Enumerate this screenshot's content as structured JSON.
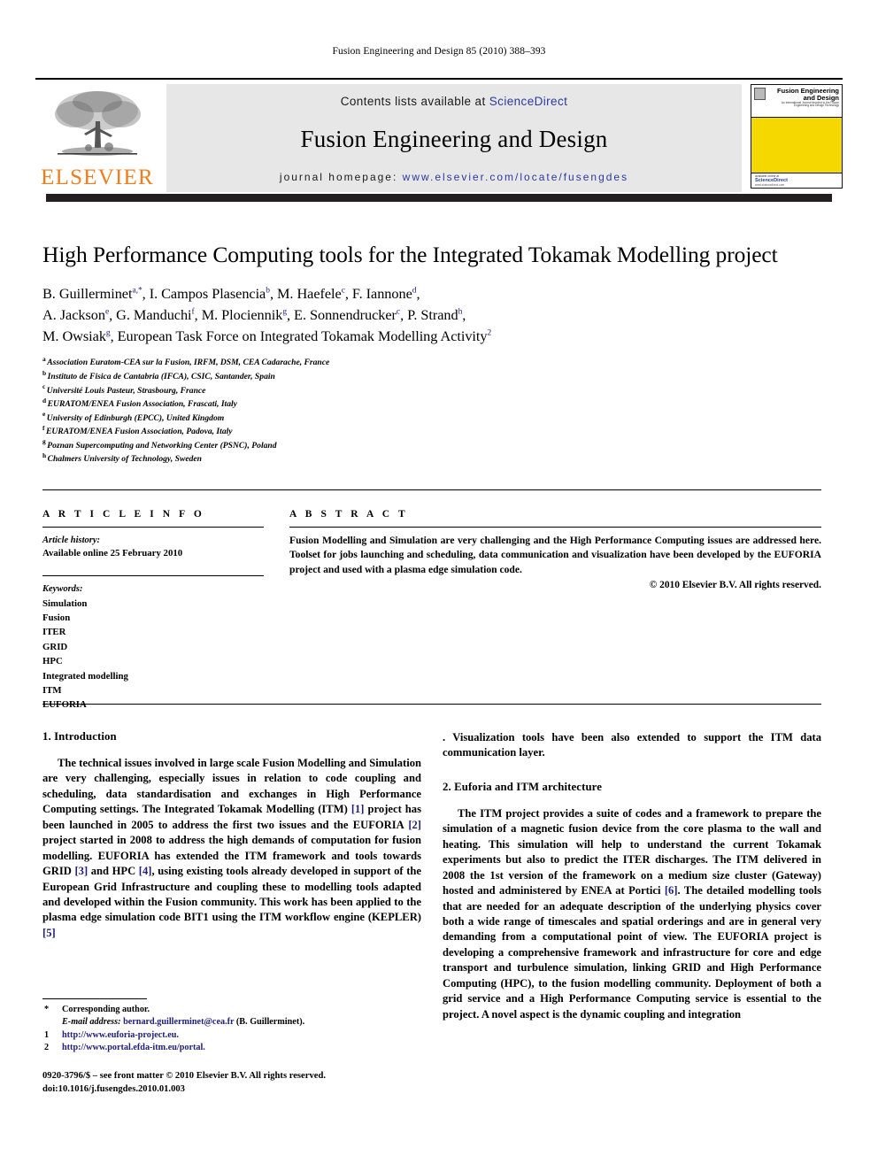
{
  "running_head": "Fusion Engineering and Design 85 (2010) 388–393",
  "masthead": {
    "contents_prefix": "Contents lists available at ",
    "sciencedirect": "ScienceDirect",
    "journal_title": "Fusion Engineering and Design",
    "homepage_prefix": "journal homepage:",
    "homepage_url": "www.elsevier.com/locate/fusengdes",
    "publisher_name": "ELSEVIER",
    "cover": {
      "title_line1": "Fusion Engineering",
      "title_line2": "and Design",
      "subtitle": "An International Journal devoted to the Fusion Engineering and Design Technology",
      "footer_line1": "available online at",
      "footer_line2": "ScienceDirect",
      "footer_line3": "www.sciencedirect.com"
    },
    "accent_link_color": "#2b3a9c",
    "elsevier_orange": "#f07d1a",
    "cover_yellow": "#f5d800",
    "band_gray": "#e7e7e8"
  },
  "article": {
    "title": "High Performance Computing tools for the Integrated Tokamak Modelling project",
    "authors_line1": "B. Guillerminet",
    "authors_html_lines": [
      "B. Guillerminet a,*, I. Campos Plasencia b, M. Haefele c, F. Iannone d,",
      "A. Jackson e, G. Manduchi f, M. Plociennik g, E. Sonnendrucker c, P. Strand h,",
      "M. Owsiak g, European Task Force on Integrated Tokamak Modelling Activity 2"
    ],
    "affiliations": [
      {
        "mark": "a",
        "text": "Association Euratom-CEA sur la Fusion, IRFM, DSM, CEA Cadarache, France"
      },
      {
        "mark": "b",
        "text": "Instituto de Fisica de Cantabria (IFCA), CSIC, Santander, Spain"
      },
      {
        "mark": "c",
        "text": "Université Louis Pasteur, Strasbourg, France"
      },
      {
        "mark": "d",
        "text": "EURATOM/ENEA Fusion Association, Frascati, Italy"
      },
      {
        "mark": "e",
        "text": "University of Edinburgh (EPCC), United Kingdom"
      },
      {
        "mark": "f",
        "text": "EURATOM/ENEA Fusion Association, Padova, Italy"
      },
      {
        "mark": "g",
        "text": "Poznan Supercomputing and Networking Center (PSNC), Poland"
      },
      {
        "mark": "h",
        "text": "Chalmers University of Technology, Sweden"
      }
    ]
  },
  "article_info": {
    "heading": "A R T I C L E   I N F O",
    "history_label": "Article history:",
    "history_value": "Available online 25 February 2010",
    "keywords_label": "Keywords:",
    "keywords": [
      "Simulation",
      "Fusion",
      "ITER",
      "GRID",
      "HPC",
      "Integrated modelling",
      "ITM",
      "EUFORIA"
    ]
  },
  "abstract": {
    "heading": "A B S T R A C T",
    "text": "Fusion Modelling and Simulation are very challenging and the High Performance Computing issues are addressed here. Toolset for jobs launching and scheduling, data communication and visualization have been developed by the EUFORIA project and used with a plasma edge simulation code.",
    "copyright": "© 2010 Elsevier B.V. All rights reserved."
  },
  "body": {
    "section1_heading": "1.  Introduction",
    "section1_par1_a": "The technical issues involved in large scale Fusion Modelling and Simulation are very challenging, especially issues in relation to code coupling and scheduling, data standardisation and exchanges in High Performance Computing settings. The Integrated Tokamak Modelling (ITM) ",
    "cite1": "[1]",
    "section1_par1_b": " project has been launched in 2005 to address the first two issues and the EUFORIA ",
    "cite2": "[2]",
    "section1_par1_c": " project started in 2008 to address the high demands of computation for fusion modelling. EUFORIA has extended the ITM framework and tools towards GRID ",
    "cite3": "[3]",
    "section1_par1_d": " and HPC ",
    "cite4": "[4]",
    "section1_par1_e": ", using existing tools already developed in support of the European Grid Infrastructure and coupling these to modelling tools adapted and developed within the Fusion community. This work has been applied to the plasma edge simulation code BIT1 using the ITM workflow engine (KEPLER) ",
    "cite5": "[5]",
    "section1_par1_f": ". Visualization tools have been also extended to support the ITM data communication layer.",
    "section2_heading": "2.  Euforia and ITM architecture",
    "section2_par1_a": "The ITM project provides a suite of codes and a framework to prepare the simulation of a magnetic fusion device from the core plasma to the wall and heating. This simulation will help to understand the current Tokamak experiments but also to predict the ITER discharges. The ITM delivered in 2008 the 1st version of the framework on a medium size cluster (Gateway) hosted and administered by ENEA at Portici ",
    "cite6": "[6]",
    "section2_par1_b": ". The detailed modelling tools that are needed for an adequate description of the underlying physics cover both a wide range of timescales and spatial orderings and are in general very demanding from a computational point of view. The EUFORIA project is developing a comprehensive framework and infrastructure for core and edge transport and turbulence simulation, linking GRID and High Performance Computing (HPC), to the fusion modelling community. Deployment of both a grid service and a High Performance Computing service is essential to the project. A novel aspect is the dynamic coupling and integration"
  },
  "footnotes": {
    "corresponding_mark": "*",
    "corresponding_text": "Corresponding author.",
    "email_label": "E-mail address:",
    "email_value": "bernard.guillerminet@cea.fr",
    "email_attrib": "(B. Guillerminet).",
    "note1_mark": "1",
    "note1_url": "http://www.euforia-project.eu.",
    "note2_mark": "2",
    "note2_url": "http://www.portal.efda-itm.eu/portal.",
    "imprint_line1": "0920-3796/$ – see front matter © 2010 Elsevier B.V. All rights reserved.",
    "imprint_line2": "doi:10.1016/j.fusengdes.2010.01.003"
  }
}
